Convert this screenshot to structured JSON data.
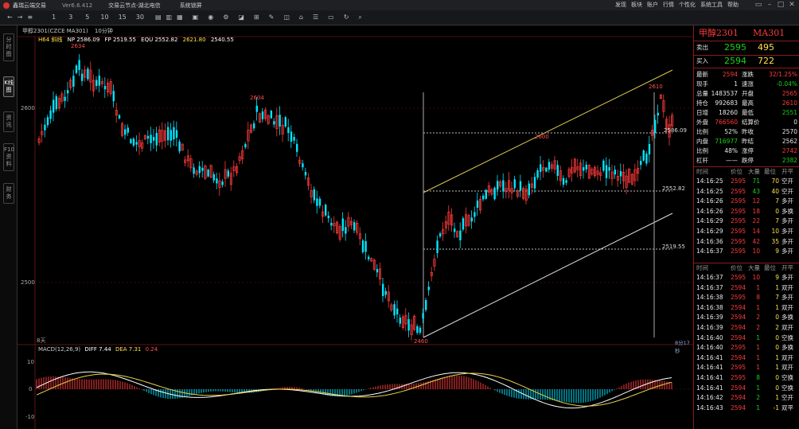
{
  "app": {
    "name": "鑫瑞云端交易",
    "version": "Ver6.6.412",
    "nav": [
      "交易云节点-湖北电信",
      "系统锁屏"
    ],
    "menu": [
      "发现",
      "板块",
      "账户",
      "行情",
      "个性化",
      "系统工具",
      "帮助"
    ],
    "colors": {
      "up": "#ff3b3b",
      "down": "#00e5ff",
      "ma": "#ffe04a"
    }
  },
  "toolbar": {
    "items": [
      "1",
      "3",
      "5",
      "10",
      "15",
      "30"
    ],
    "icons": [
      "back-icon",
      "forward-icon",
      "menu-icon",
      "period-d-icon",
      "period-w-icon",
      "period-m-icon",
      "chart-icon",
      "eye-icon",
      "gear-icon",
      "eraser-icon",
      "grid-icon",
      "pin-icon",
      "draw-icon",
      "home-icon",
      "list-icon",
      "window-icon",
      "refresh-icon",
      "search-icon"
    ]
  },
  "left_tabs": [
    "分时图",
    "K线图",
    "资讯",
    "F10资料",
    "财务"
  ],
  "chart": {
    "info": {
      "code": "MA301",
      "contract": "甲醇2301(CZCE MA301)",
      "period": "10分钟",
      "indicator": "H64 斜线",
      "np": "NP 2586.09",
      "fp": "FP 2519.55",
      "equ": "EQU 2552.82",
      "v1": "2621.80",
      "v2": "2540.55"
    },
    "y_labels": {
      "p2600": "2600",
      "p2500": "2500"
    },
    "price_marks": [
      "2634",
      "2604",
      "2460",
      "2600",
      "2610"
    ],
    "right_labels": [
      "2586.09",
      "2552.82",
      "2519.55"
    ],
    "bottom_left": "8天",
    "bottom_right": "8分17秒",
    "macd": {
      "title": "MACD(12,26,9)",
      "diff": "DIFF 7.44",
      "dea": "DEA 7.31",
      "macd": "0.24",
      "y10": "10",
      "y0": "0",
      "yn10": "-10"
    }
  },
  "quote": {
    "name": "甲醇2301",
    "code": "MA301",
    "sell_label": "卖出",
    "sell_price": "2595",
    "sell_vol": "495",
    "buy_label": "买入",
    "buy_price": "2594",
    "buy_vol": "722",
    "stats": [
      {
        "l1": "最新",
        "v1": "2594",
        "c1": "red",
        "l2": "涨跌",
        "v2": "32/1.25%",
        "c2": "red"
      },
      {
        "l1": "现手",
        "v1": "1",
        "c1": "wht",
        "l2": "速涨",
        "v2": "-0.04%",
        "c2": "green"
      },
      {
        "l1": "总量",
        "v1": "1483537",
        "c1": "wht",
        "l2": "开盘",
        "v2": "2565",
        "c2": "red"
      },
      {
        "l1": "持仓",
        "v1": "992683",
        "c1": "wht",
        "l2": "最高",
        "v2": "2610",
        "c2": "red"
      },
      {
        "l1": "日增",
        "v1": "18260",
        "c1": "wht",
        "l2": "最低",
        "v2": "2551",
        "c2": "green"
      },
      {
        "l1": "外盘",
        "v1": "766560",
        "c1": "red",
        "l2": "结算价",
        "v2": "0",
        "c2": "wht"
      },
      {
        "l1": "比例",
        "v1": "52%",
        "c1": "wht",
        "l2": "昨收",
        "v2": "2570",
        "c2": "wht"
      },
      {
        "l1": "内盘",
        "v1": "716977",
        "c1": "green",
        "l2": "昨结",
        "v2": "2562",
        "c2": "wht"
      },
      {
        "l1": "比例",
        "v1": "48%",
        "c1": "wht",
        "l2": "涨停",
        "v2": "2742",
        "c2": "red"
      },
      {
        "l1": "杠杆",
        "v1": "——",
        "c1": "wht",
        "l2": "跌停",
        "v2": "2382",
        "c2": "green"
      }
    ],
    "tick_header": [
      "时间",
      "价位",
      "大量",
      "最位",
      "开平"
    ],
    "ticks_a": [
      {
        "t": "14:16:25",
        "p": "2595",
        "v": "71",
        "z": "70",
        "k": "空开"
      },
      {
        "t": "14:16:25",
        "p": "2595",
        "v": "43",
        "z": "40",
        "k": "空开"
      },
      {
        "t": "14:16:26",
        "p": "2595",
        "v": "12",
        "z": "7",
        "k": "多开"
      },
      {
        "t": "14:16:26",
        "p": "2595",
        "v": "18",
        "z": "0",
        "k": "多换"
      },
      {
        "t": "14:16:29",
        "p": "2595",
        "v": "22",
        "z": "7",
        "k": "多开"
      },
      {
        "t": "14:16:29",
        "p": "2595",
        "v": "14",
        "z": "10",
        "k": "多开"
      },
      {
        "t": "14:16:36",
        "p": "2595",
        "v": "42",
        "z": "35",
        "k": "多开"
      },
      {
        "t": "14:16:37",
        "p": "2595",
        "v": "10",
        "z": "9",
        "k": "多开"
      }
    ],
    "ticks_b": [
      {
        "t": "14:16:37",
        "p": "2595",
        "v": "10",
        "z": "9",
        "k": "多开"
      },
      {
        "t": "14:16:37",
        "p": "2594",
        "v": "1",
        "z": "1",
        "k": "双开"
      },
      {
        "t": "14:16:38",
        "p": "2595",
        "v": "8",
        "z": "7",
        "k": "多开"
      },
      {
        "t": "14:16:38",
        "p": "2594",
        "v": "1",
        "z": "1",
        "k": "双开"
      },
      {
        "t": "14:16:39",
        "p": "2594",
        "v": "2",
        "z": "0",
        "k": "多换"
      },
      {
        "t": "14:16:39",
        "p": "2594",
        "v": "2",
        "z": "2",
        "k": "双开"
      },
      {
        "t": "14:16:40",
        "p": "2594",
        "v": "1",
        "z": "0",
        "k": "空换"
      },
      {
        "t": "14:16:40",
        "p": "2595",
        "v": "1",
        "z": "0",
        "k": "多换"
      },
      {
        "t": "14:16:41",
        "p": "2594",
        "v": "1",
        "z": "1",
        "k": "双开"
      },
      {
        "t": "14:16:41",
        "p": "2595",
        "v": "1",
        "z": "1",
        "k": "双开"
      },
      {
        "t": "14:16:41",
        "p": "2595",
        "v": "8",
        "z": "0",
        "k": "空换"
      },
      {
        "t": "14:16:41",
        "p": "2594",
        "v": "1",
        "z": "0",
        "k": "空换"
      },
      {
        "t": "14:16:42",
        "p": "2594",
        "v": "2",
        "z": "1",
        "k": "空开"
      },
      {
        "t": "14:16:43",
        "p": "2594",
        "v": "1",
        "z": "-1",
        "k": "双平"
      }
    ]
  }
}
